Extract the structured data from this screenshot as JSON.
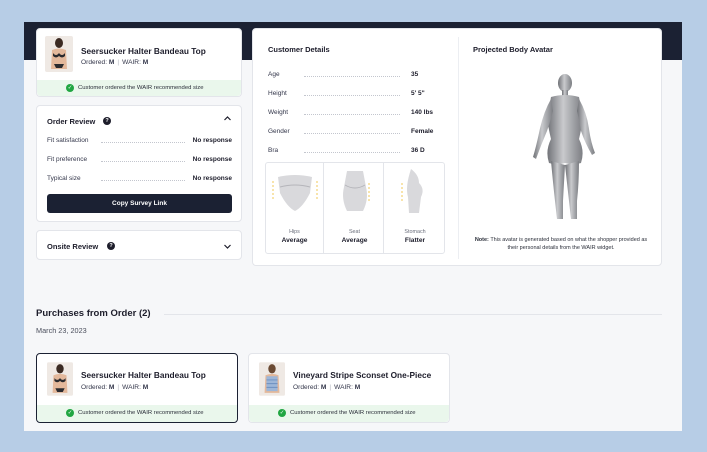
{
  "header_product": {
    "name": "Seersucker Halter Bandeau Top",
    "ordered_label": "Ordered:",
    "ordered_value": "M",
    "wair_label": "WAIR:",
    "wair_value": "M",
    "recommendation_note": "Customer ordered the WAIR recommended size"
  },
  "order_review": {
    "title": "Order Review",
    "rows": [
      {
        "label": "Fit satisfaction",
        "value": "No response"
      },
      {
        "label": "Fit preference",
        "value": "No response"
      },
      {
        "label": "Typical size",
        "value": "No response"
      }
    ],
    "button_label": "Copy Survey Link"
  },
  "onsite_review": {
    "title": "Onsite Review"
  },
  "customer_details": {
    "title": "Customer Details",
    "rows": [
      {
        "label": "Age",
        "value": "35"
      },
      {
        "label": "Height",
        "value": "5' 5\""
      },
      {
        "label": "Weight",
        "value": "140 lbs"
      },
      {
        "label": "Gender",
        "value": "Female"
      },
      {
        "label": "Bra",
        "value": "36 D"
      }
    ],
    "shapes": [
      {
        "label": "Hips",
        "value": "Average"
      },
      {
        "label": "Seat",
        "value": "Average"
      },
      {
        "label": "Stomach",
        "value": "Flatter"
      }
    ]
  },
  "avatar": {
    "title": "Projected Body Avatar",
    "note_label": "Note:",
    "note_text": "This avatar is generated based on what the shopper provided as their personal details from the WAIR widget."
  },
  "purchases": {
    "title": "Purchases from Order (2)",
    "date": "March 23, 2023",
    "items": [
      {
        "name": "Seersucker Halter Bandeau Top",
        "ordered_label": "Ordered:",
        "ordered_value": "M",
        "wair_label": "WAIR:",
        "wair_value": "M",
        "note": "Customer ordered the WAIR recommended size",
        "selected": true
      },
      {
        "name": "Vineyard Stripe Sconset One-Piece",
        "ordered_label": "Ordered:",
        "ordered_value": "M",
        "wair_label": "WAIR:",
        "wair_value": "M",
        "note": "Customer ordered the WAIR recommended size",
        "selected": false
      }
    ]
  },
  "colors": {
    "navy": "#1b2133",
    "success_green": "#21a642",
    "success_bg": "#eaf7ec",
    "frame_bg": "#b7cde6"
  },
  "icons": {
    "check": "check-circle-icon",
    "help": "question-circle-icon",
    "chevron_up": "chevron-up-icon",
    "chevron_down": "chevron-down-icon"
  }
}
